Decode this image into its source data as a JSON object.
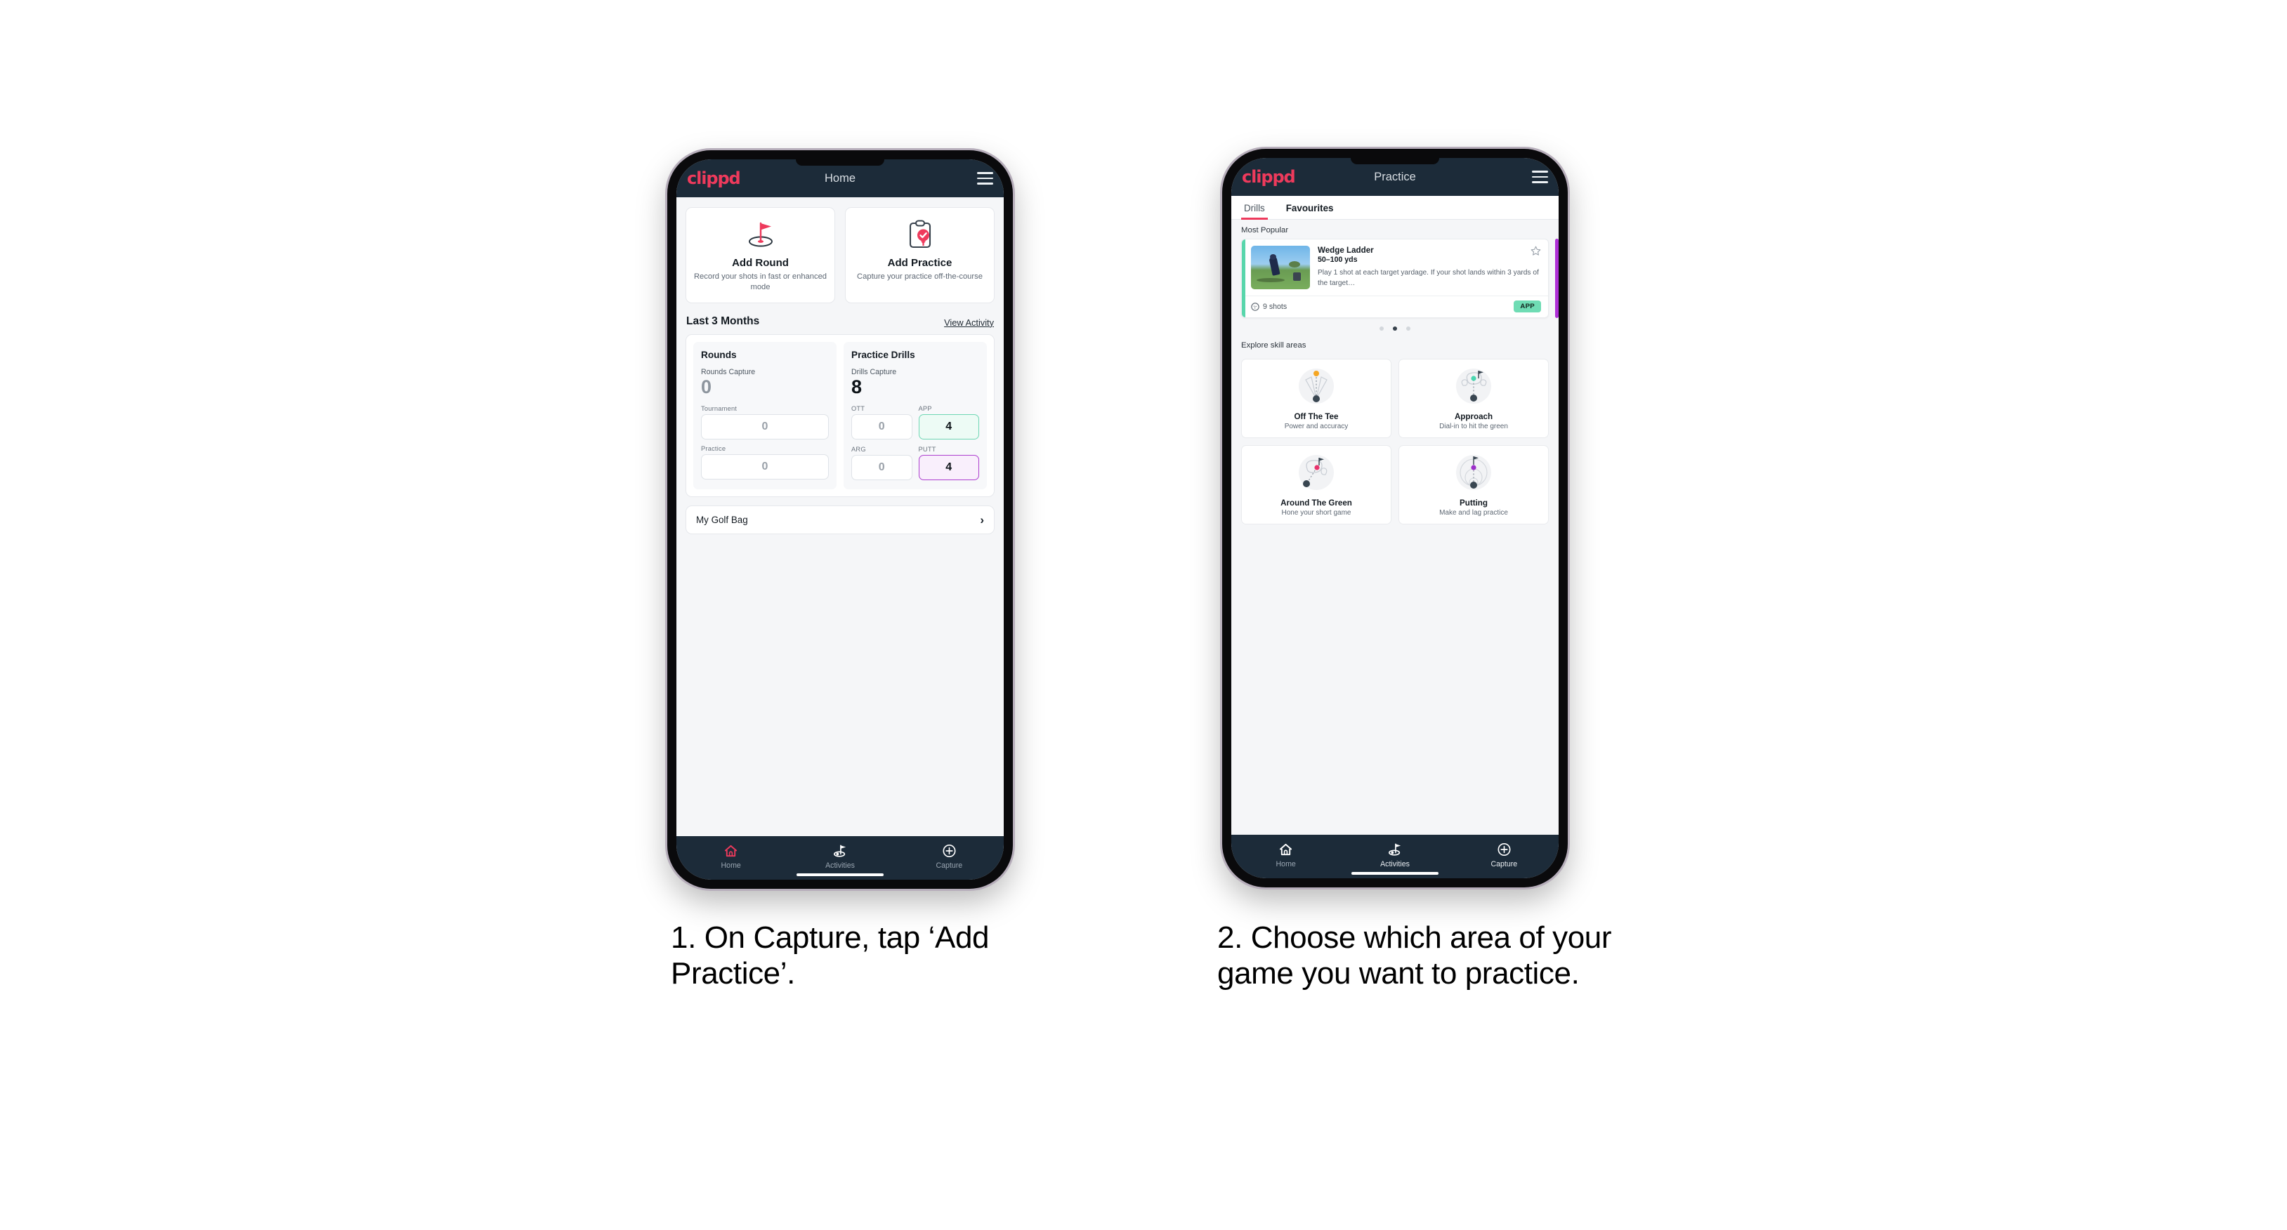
{
  "brand": "clippd",
  "phone1": {
    "appbar": {
      "title": "Home",
      "menu_icon": "hamburger-icon"
    },
    "quick_actions": [
      {
        "icon": "golf-flag-hole-icon",
        "title": "Add Round",
        "subtitle": "Record your shots in fast or enhanced mode"
      },
      {
        "icon": "clipboard-check-icon",
        "title": "Add Practice",
        "subtitle": "Capture your practice off-the-course"
      }
    ],
    "section": {
      "title": "Last 3 Months",
      "link": "View Activity"
    },
    "stats": {
      "rounds": {
        "heading": "Rounds",
        "capture_label": "Rounds Capture",
        "capture_value": "0",
        "rows": [
          {
            "label": "Tournament",
            "value": "0",
            "highlight": "none"
          },
          {
            "label": "Practice",
            "value": "0",
            "highlight": "none"
          }
        ]
      },
      "drills": {
        "heading": "Practice Drills",
        "capture_label": "Drills Capture",
        "capture_value": "8",
        "rows": [
          {
            "label": "OTT",
            "value": "0",
            "highlight": "none"
          },
          {
            "label": "APP",
            "value": "4",
            "highlight": "green"
          },
          {
            "label": "ARG",
            "value": "0",
            "highlight": "none"
          },
          {
            "label": "PUTT",
            "value": "4",
            "highlight": "purple"
          }
        ]
      }
    },
    "golf_bag": {
      "label": "My Golf Bag",
      "chevron": "chevron-right-icon"
    },
    "bottom_nav": [
      {
        "label": "Home",
        "icon": "home-icon",
        "state": "active"
      },
      {
        "label": "Activities",
        "icon": "golf-flag-icon",
        "state": "inactive"
      },
      {
        "label": "Capture",
        "icon": "plus-circle-icon",
        "state": "inactive"
      }
    ]
  },
  "phone2": {
    "appbar": {
      "title": "Practice",
      "menu_icon": "hamburger-icon"
    },
    "tabs": [
      {
        "label": "Drills",
        "selected": true
      },
      {
        "label": "Favourites",
        "selected": false
      }
    ],
    "most_popular_label": "Most Popular",
    "drill": {
      "name": "Wedge Ladder",
      "yardage": "50–100 yds",
      "description": "Play 1 shot at each target yardage. If your shot lands within 3 yards of the target…",
      "shots": "9 shots",
      "shots_icon": "golf-ball-icon",
      "badge": "APP",
      "badge_color": "#6fdcb4",
      "accent_color": "#58d6ab",
      "next_accent_color": "#ae2fd6",
      "favourite_icon": "star-outline-icon",
      "thumbnail": "golfer-chipping-photo"
    },
    "carousel_dots": [
      false,
      true,
      false
    ],
    "explore_label": "Explore skill areas",
    "skill_areas": [
      {
        "name": "Off The Tee",
        "subtitle": "Power and accuracy",
        "icon": "tee-shot-dispersion-icon",
        "dot_color": "#f5a623"
      },
      {
        "name": "Approach",
        "subtitle": "Dial-in to hit the green",
        "icon": "approach-green-icon",
        "dot_color": "#4ad6b0"
      },
      {
        "name": "Around The Green",
        "subtitle": "Hone your short game",
        "icon": "chip-green-icon",
        "dot_color": "#e8336d"
      },
      {
        "name": "Putting",
        "subtitle": "Make and lag practice",
        "icon": "putting-rings-icon",
        "dot_color": "#9b30c9"
      }
    ],
    "bottom_nav": [
      {
        "label": "Home",
        "icon": "home-icon",
        "state": "inactive"
      },
      {
        "label": "Activities",
        "icon": "golf-flag-icon",
        "state": "inactive"
      },
      {
        "label": "Capture",
        "icon": "plus-circle-icon",
        "state": "inactive"
      }
    ]
  },
  "captions": {
    "one": "1. On Capture, tap ‘Add Practice’.",
    "two": "2. Choose which area of your game you want to practice."
  },
  "colors": {
    "brand_pink": "#ee3a5c",
    "header_navy": "#1c2b39",
    "green": "#6fdcb4",
    "purple": "#ad3fcf"
  }
}
